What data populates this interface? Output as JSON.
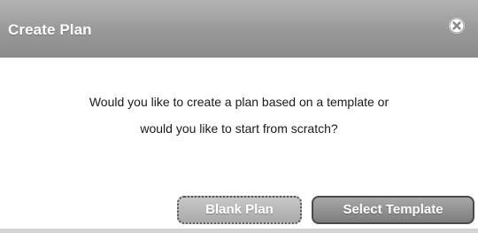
{
  "dialog": {
    "title": "Create Plan",
    "message_line1": "Would you like to create a plan based on a template or",
    "message_line2": "would you like to start from scratch?",
    "close_icon": "close-circle-icon"
  },
  "buttons": {
    "blank_label": "Blank Plan",
    "template_label": "Select Template"
  },
  "colors": {
    "titlebar": "#9a9a9a",
    "button": "#8f8f8f",
    "title_text": "#ffffff"
  }
}
